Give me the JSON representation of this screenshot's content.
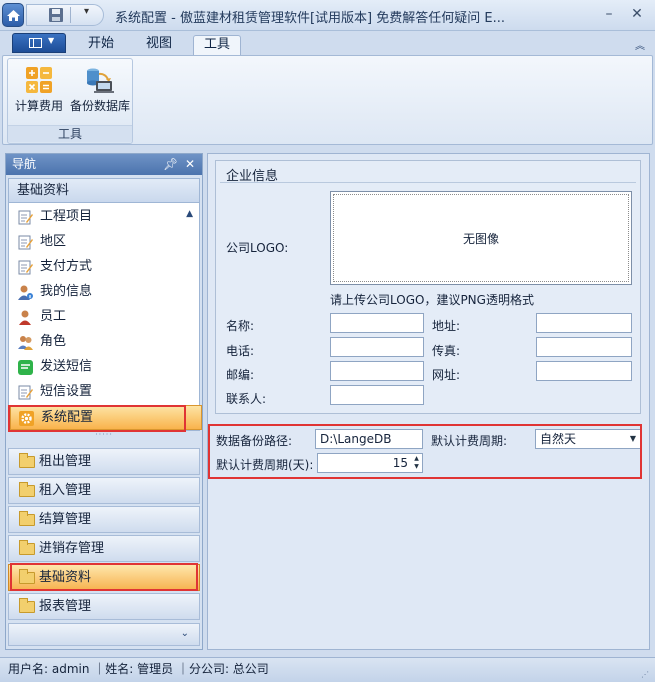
{
  "window": {
    "title": "系统配置 - 傲蓝建材租赁管理软件[试用版本] 免费解答任何疑问 E...",
    "minimize": "–",
    "close": "✕"
  },
  "ribbon": {
    "tabs": [
      "开始",
      "视图",
      "工具"
    ],
    "active_tab": "工具",
    "collapse_glyph": "︽",
    "group_label": "工具",
    "buttons": [
      "计算费用",
      "备份数据库"
    ]
  },
  "nav": {
    "header": "导航",
    "pin": "ꟷ",
    "close": "✕",
    "section_title": "基础资料",
    "items": [
      "工程项目",
      "地区",
      "支付方式",
      "我的信息",
      "员工",
      "角色",
      "发送短信",
      "短信设置",
      "系统配置"
    ],
    "selected_item": "系统配置",
    "groups": [
      "租出管理",
      "租入管理",
      "结算管理",
      "进销存管理",
      "基础资料",
      "报表管理"
    ],
    "selected_group": "基础资料",
    "footer_glyph": "⌄"
  },
  "corp": {
    "title": "企业信息",
    "logo_label": "公司LOGO:",
    "logo_placeholder": "无图像",
    "logo_hint": "请上传公司LOGO，建议PNG透明格式",
    "name_label": "名称:",
    "name_value": "",
    "address_label": "地址:",
    "address_value": "",
    "phone_label": "电话:",
    "phone_value": "",
    "fax_label": "传真:",
    "fax_value": "",
    "zip_label": "邮编:",
    "zip_value": "",
    "website_label": "网址:",
    "website_value": "",
    "contact_label": "联系人:",
    "contact_value": ""
  },
  "backup": {
    "path_label": "数据备份路径:",
    "path_value": "D:\\LangeDB",
    "period_label": "默认计费周期:",
    "period_value": "自然天",
    "days_label": "默认计费周期(天):",
    "days_value": "15"
  },
  "status": {
    "text": "用户名: admin ｜姓名: 管理员 ｜分公司: 总公司"
  },
  "colors": {
    "highlight_red": "#e03434",
    "selection_orange": "#f9b34c"
  }
}
